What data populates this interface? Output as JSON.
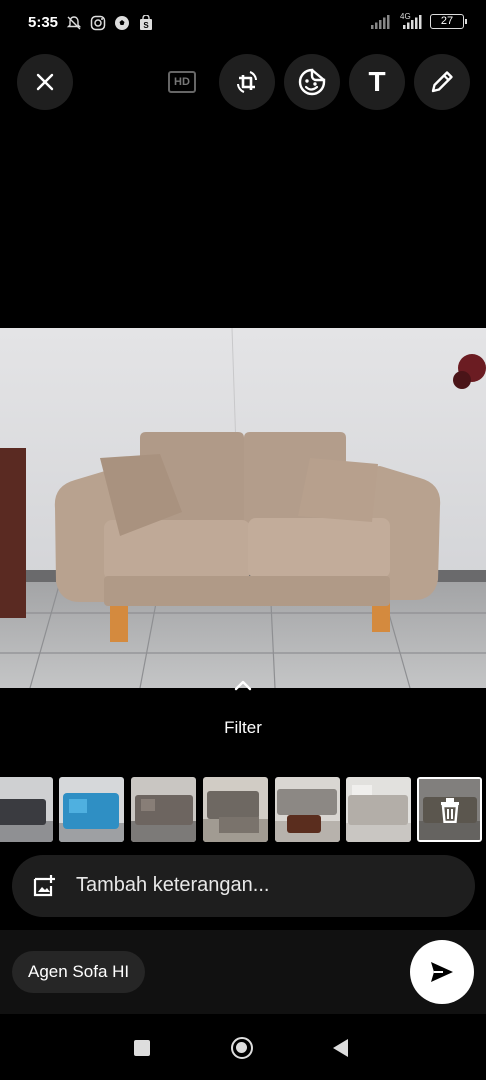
{
  "status_bar": {
    "time": "5:35",
    "network": "4G",
    "battery": "27",
    "left_icons": [
      "mute-bell-icon",
      "instagram-icon",
      "soccer-ball-icon",
      "shop-bag-icon"
    ]
  },
  "toolbar": {
    "close_icon": "close-icon",
    "hd_label": "HD",
    "tools": [
      "crop-rotate-icon",
      "sticker-icon",
      "text-icon",
      "pencil-icon"
    ],
    "text_tool_glyph": "T"
  },
  "filter": {
    "label": "Filter"
  },
  "thumbnails": {
    "count": 7,
    "selected_index": 6
  },
  "caption": {
    "placeholder": "Tambah keterangan..."
  },
  "recipient": {
    "name": "Agen Sofa HI"
  },
  "colors": {
    "background": "#000000",
    "surface": "#1e1e1e",
    "chip": "#262626",
    "send_button": "#ffffff"
  }
}
